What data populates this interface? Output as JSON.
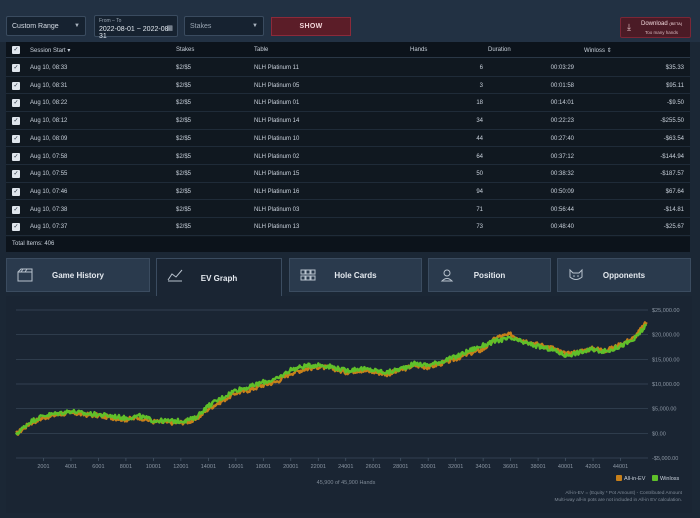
{
  "filters": {
    "range_select": "Custom Range",
    "date_label": "From – To",
    "date_value": "2022-08-01 ~ 2022-08-31",
    "stakes_placeholder": "Stakes",
    "show_label": "SHOW",
    "download_label": "Download",
    "download_beta": "(BETA)",
    "download_sub": "Too many hands"
  },
  "table": {
    "columns": [
      "Session Start",
      "Stakes",
      "Table",
      "Hands",
      "Duration",
      "Winloss"
    ],
    "rows": [
      {
        "start": "Aug 10, 08:33",
        "stakes": "$2/$5",
        "table": "NLH Platinum 11",
        "hands": "6",
        "duration": "00:03:29",
        "winloss": "$35.33"
      },
      {
        "start": "Aug 10, 08:31",
        "stakes": "$2/$5",
        "table": "NLH Platinum 05",
        "hands": "3",
        "duration": "00:01:58",
        "winloss": "$95.11"
      },
      {
        "start": "Aug 10, 08:22",
        "stakes": "$2/$5",
        "table": "NLH Platinum 01",
        "hands": "18",
        "duration": "00:14:01",
        "winloss": "-$9.50"
      },
      {
        "start": "Aug 10, 08:12",
        "stakes": "$2/$5",
        "table": "NLH Platinum 14",
        "hands": "34",
        "duration": "00:22:23",
        "winloss": "-$255.50"
      },
      {
        "start": "Aug 10, 08:09",
        "stakes": "$2/$5",
        "table": "NLH Platinum 10",
        "hands": "44",
        "duration": "00:27:40",
        "winloss": "-$63.54"
      },
      {
        "start": "Aug 10, 07:58",
        "stakes": "$2/$5",
        "table": "NLH Platinum 02",
        "hands": "64",
        "duration": "00:37:12",
        "winloss": "-$144.94"
      },
      {
        "start": "Aug 10, 07:55",
        "stakes": "$2/$5",
        "table": "NLH Platinum 15",
        "hands": "50",
        "duration": "00:38:32",
        "winloss": "-$187.57"
      },
      {
        "start": "Aug 10, 07:46",
        "stakes": "$2/$5",
        "table": "NLH Platinum 16",
        "hands": "94",
        "duration": "00:50:09",
        "winloss": "$67.64"
      },
      {
        "start": "Aug 10, 07:38",
        "stakes": "$2/$5",
        "table": "NLH Platinum 03",
        "hands": "71",
        "duration": "00:56:44",
        "winloss": "-$14.81"
      },
      {
        "start": "Aug 10, 07:37",
        "stakes": "$2/$5",
        "table": "NLH Platinum 13",
        "hands": "73",
        "duration": "00:48:40",
        "winloss": "-$25.67"
      }
    ],
    "total_label": "Total Items: 406"
  },
  "tabs": [
    {
      "label": "Game History",
      "icon": "film-icon"
    },
    {
      "label": "EV Graph",
      "icon": "line-chart-icon"
    },
    {
      "label": "Hole Cards",
      "icon": "grid-icon"
    },
    {
      "label": "Position",
      "icon": "location-icon"
    },
    {
      "label": "Opponents",
      "icon": "cat-face-icon"
    }
  ],
  "colors": {
    "allin_ev": "#c8801a",
    "winloss": "#5fc02a",
    "accent": "#8c2a3a"
  },
  "chart_data": {
    "type": "line",
    "title": "",
    "x_ticks": [
      "2001",
      "4001",
      "6001",
      "8001",
      "10001",
      "12001",
      "14001",
      "16001",
      "18001",
      "20001",
      "22001",
      "24001",
      "26001",
      "28001",
      "30001",
      "32001",
      "34001",
      "36001",
      "38001",
      "40001",
      "42001",
      "44001"
    ],
    "y_ticks": [
      "$25,000.00",
      "$20,000.00",
      "$15,000.00",
      "$10,000.00",
      "$5,000.00",
      "$0.00",
      "-$5,000.00"
    ],
    "xlim": [
      1,
      46000
    ],
    "ylim": [
      -5000,
      25000
    ],
    "x": [
      1,
      1000,
      2000,
      3000,
      4000,
      5000,
      6000,
      7000,
      8000,
      9000,
      10000,
      11000,
      12000,
      13000,
      14000,
      15000,
      16000,
      17000,
      18000,
      19000,
      20000,
      21000,
      22000,
      23000,
      24000,
      25000,
      26000,
      27000,
      28000,
      29000,
      30000,
      31000,
      32000,
      33000,
      34000,
      35000,
      36000,
      37000,
      38000,
      39000,
      40000,
      41000,
      42000,
      43000,
      44000,
      45000,
      45900
    ],
    "series": [
      {
        "name": "All-in-EV",
        "values": [
          -200,
          2000,
          3200,
          3800,
          4200,
          3800,
          3600,
          3200,
          2800,
          3200,
          2400,
          2200,
          2200,
          2600,
          5000,
          6600,
          8200,
          8800,
          9800,
          10500,
          12200,
          13000,
          13500,
          13200,
          12400,
          12800,
          12500,
          12000,
          12800,
          13800,
          13400,
          14200,
          15100,
          16200,
          17000,
          19500,
          20000,
          18800,
          18000,
          17400,
          16000,
          16600,
          17200,
          16800,
          18000,
          19400,
          22500
        ]
      },
      {
        "name": "Winloss",
        "values": [
          -200,
          2300,
          3600,
          4000,
          4500,
          4000,
          3800,
          3500,
          3100,
          3500,
          2600,
          2500,
          2500,
          3000,
          5600,
          7200,
          8800,
          9400,
          10400,
          11000,
          12900,
          13600,
          13900,
          13500,
          12700,
          13100,
          12800,
          12300,
          13100,
          14100,
          13800,
          14600,
          15500,
          16800,
          17800,
          18800,
          19200,
          18400,
          17600,
          17000,
          15800,
          16400,
          17000,
          16600,
          17700,
          19000,
          22000
        ]
      }
    ],
    "hands_label": "45,900 of 45,900 Hands",
    "legend": [
      "All-in-EV",
      "Winloss"
    ],
    "legend_position": "bottom-right",
    "footnote1": "All-in-EV = (Equity * Pot Amount) - Contributed Amount",
    "footnote2": "Multi-way all-in pots are not included in All-in EV calculation.",
    "grid": true
  }
}
